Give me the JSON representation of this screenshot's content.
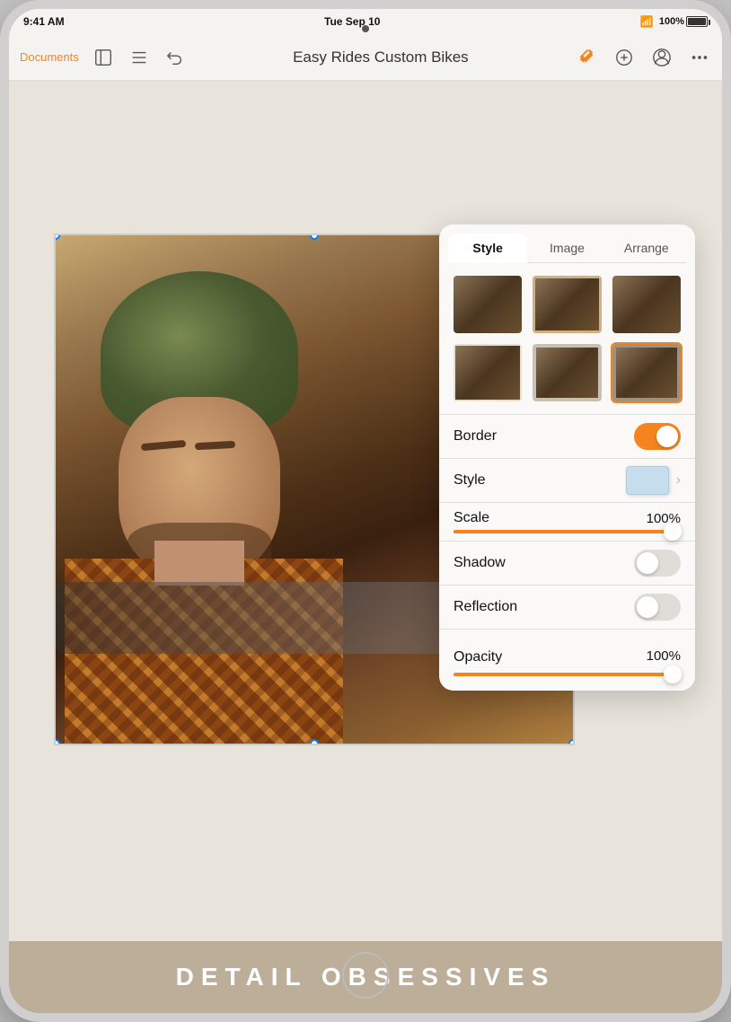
{
  "status_bar": {
    "time": "9:41 AM",
    "date": "Tue Sep 10",
    "battery": "100%"
  },
  "toolbar": {
    "documents_label": "Documents",
    "title": "Easy Rides Custom Bikes",
    "undo_tooltip": "Undo"
  },
  "format_panel": {
    "tabs": [
      {
        "id": "style",
        "label": "Style",
        "active": true
      },
      {
        "id": "image",
        "label": "Image",
        "active": false
      },
      {
        "id": "arrange",
        "label": "Arrange",
        "active": false
      }
    ],
    "border": {
      "label": "Border",
      "enabled": true
    },
    "style_row": {
      "label": "Style",
      "chevron": "›"
    },
    "scale": {
      "label": "Scale",
      "value": "100%",
      "fill_percent": 100
    },
    "shadow": {
      "label": "Shadow",
      "enabled": false
    },
    "reflection": {
      "label": "Reflection",
      "enabled": false
    },
    "opacity": {
      "label": "Opacity",
      "value": "100%",
      "fill_percent": 100
    }
  },
  "canvas": {
    "bottom_text": "DETAIL OBSESSIVES"
  }
}
